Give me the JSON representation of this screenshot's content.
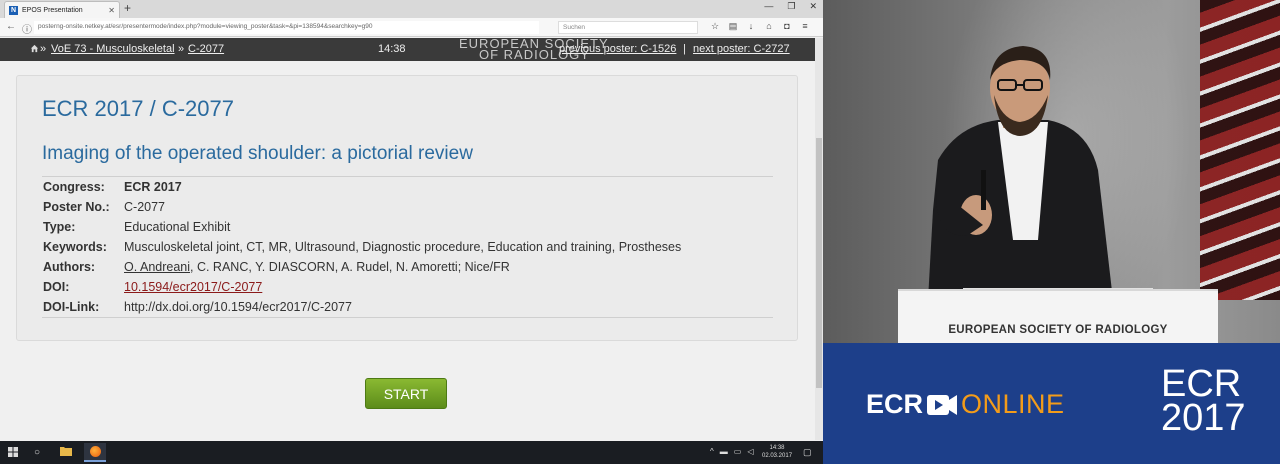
{
  "browser": {
    "tab_title": "EPOS Presentation",
    "tab_favicon": "N",
    "new_tab": "+",
    "url": "posterng-onsite.netkey.at/esr/presentermode/index.php?module=viewing_poster&task=&pi=138594&searchkey=g90",
    "search_placeholder": "Suchen"
  },
  "poster_nav": {
    "crumb_sep": "»",
    "crumb_1": "VoE 73 - Musculoskeletal",
    "crumb_2": "C-2077",
    "time": "14:38",
    "logo_line1": "EUROPEAN SOCIETY",
    "logo_line2": "OF RADIOLOGY",
    "prev_poster": "previous poster: C-1526",
    "pipe": "|",
    "next_poster": "next poster: C-2727"
  },
  "poster": {
    "id": "ECR 2017 / C-2077",
    "title": "Imaging of the operated shoulder: a pictorial review",
    "meta": {
      "congress_label": "Congress:",
      "congress_value": "ECR 2017",
      "poster_no_label": "Poster No.:",
      "poster_no_value": "C-2077",
      "type_label": "Type:",
      "type_value": "Educational Exhibit",
      "keywords_label": "Keywords:",
      "keywords_value": "Musculoskeletal joint, CT, MR, Ultrasound, Diagnostic procedure, Education and training, Prostheses",
      "authors_label": "Authors:",
      "author_first": "O. Andreani",
      "authors_rest": ", C. RANC, Y. DIASCORN, A. Rudel, N. Amoretti; Nice/FR",
      "doi_label": "DOI:",
      "doi_value": "10.1594/ecr2017/C-2077",
      "doi_link_label": "DOI-Link:",
      "doi_link_value": "http://dx.doi.org/10.1594/ecr2017/C-2077"
    },
    "start_label": "START"
  },
  "taskbar": {
    "clock_time": "14:38",
    "clock_date": "02.03.2017"
  },
  "video": {
    "podium_label": "EUROPEAN SOCIETY OF RADIOLOGY"
  },
  "brand": {
    "ecr": "ECR",
    "online": "ONLINE",
    "year_top": "ECR",
    "year_bottom": "2017"
  },
  "colors": {
    "link_blue": "#2a6a9e",
    "doi_red": "#8b1a1a",
    "start_green": "#6fa224",
    "brand_blue": "#1d3f8a",
    "online_orange": "#f39c1a"
  }
}
